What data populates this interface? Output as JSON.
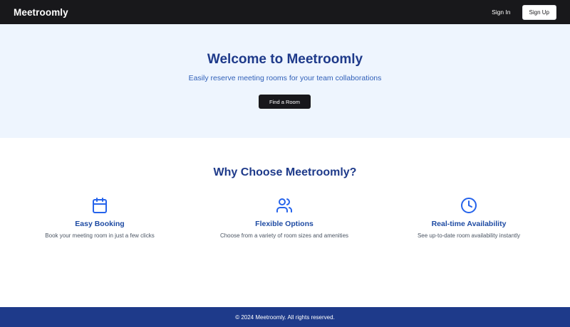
{
  "navbar": {
    "brand": "Meetroomly",
    "signin_label": "Sign In",
    "signup_label": "Sign Up"
  },
  "hero": {
    "title": "Welcome to Meetroomly",
    "subtitle": "Easily reserve meeting rooms for your team collaborations",
    "cta_label": "Find a Room"
  },
  "features": {
    "title": "Why Choose Meetroomly?",
    "items": [
      {
        "icon": "calendar-icon",
        "title": "Easy Booking",
        "description": "Book your meeting room in just a few clicks"
      },
      {
        "icon": "users-icon",
        "title": "Flexible Options",
        "description": "Choose from a variety of room sizes and amenities"
      },
      {
        "icon": "clock-icon",
        "title": "Real-time Availability",
        "description": "See up-to-date room availability instantly"
      }
    ]
  },
  "footer": {
    "text": "© 2024 Meetroomly. All rights reserved."
  },
  "colors": {
    "navbar_bg": "#18181b",
    "hero_bg": "#eef5fe",
    "accent": "#1e3a8a",
    "icon": "#2563eb"
  }
}
